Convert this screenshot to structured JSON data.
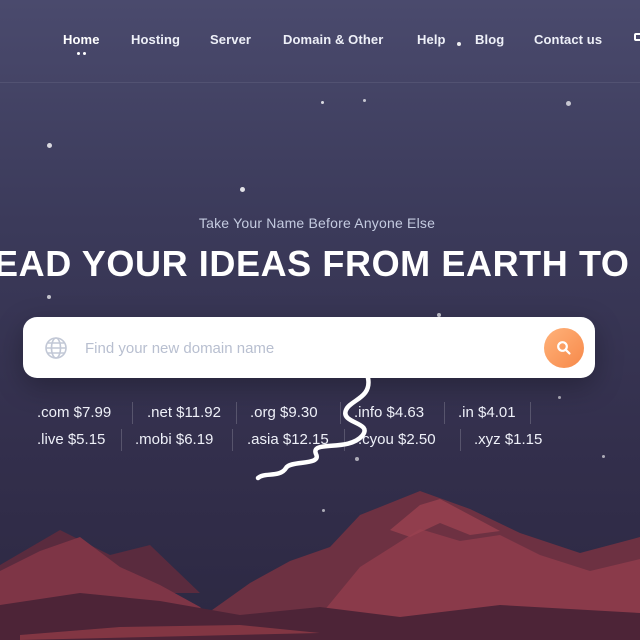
{
  "nav": {
    "items": [
      {
        "label": "Home",
        "active": true
      },
      {
        "label": "Hosting",
        "active": false
      },
      {
        "label": "Server",
        "active": false
      },
      {
        "label": "Domain & Other",
        "active": false
      },
      {
        "label": "Help",
        "active": false
      },
      {
        "label": "Blog",
        "active": false
      },
      {
        "label": "Contact us",
        "active": false
      }
    ]
  },
  "hero": {
    "tagline": "Take Your Name Before Anyone Else",
    "headline": "EAD YOUR IDEAS FROM EARTH TO M"
  },
  "search": {
    "placeholder": "Find your new domain name",
    "icon": "globe-icon",
    "button_icon": "search-icon"
  },
  "prices": {
    "row1": [
      ".com $7.99",
      ".net $11.92",
      ".org $9.30",
      ".info $4.63",
      ".in $4.01"
    ],
    "row2": [
      ".live $5.15",
      ".mobi $6.19",
      ".asia $12.15",
      ".cyou $2.50",
      ".xyz $1.15"
    ]
  },
  "colors": {
    "background": "#3b3a5a",
    "accent": "#f7894a",
    "mountain_dark": "#5a2b3e",
    "mountain_mid": "#7e3546",
    "mountain_light": "#9a4250"
  }
}
